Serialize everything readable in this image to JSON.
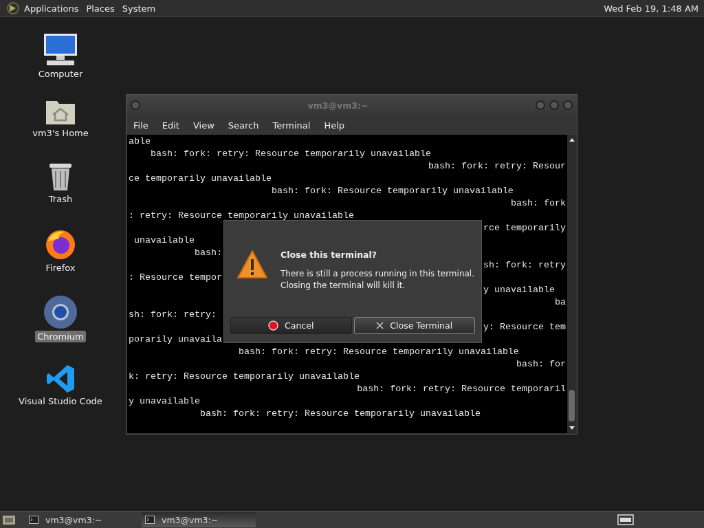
{
  "top_panel": {
    "menus": [
      "Applications",
      "Places",
      "System"
    ],
    "clock": "Wed Feb 19, 1:48 AM"
  },
  "desktop_icons": [
    {
      "kind": "computer",
      "label": "Computer",
      "selected": false
    },
    {
      "kind": "home",
      "label": "vm3's Home",
      "selected": false
    },
    {
      "kind": "trash",
      "label": "Trash",
      "selected": false
    },
    {
      "kind": "firefox",
      "label": "Firefox",
      "selected": false
    },
    {
      "kind": "chromium",
      "label": "Chromium",
      "selected": true
    },
    {
      "kind": "vscode",
      "label": "Visual Studio Code",
      "selected": false
    }
  ],
  "terminal": {
    "title": "vm3@vm3:~",
    "menu": [
      "File",
      "Edit",
      "View",
      "Search",
      "Terminal",
      "Help"
    ],
    "lines": [
      {
        "left": "able"
      },
      {
        "left": "    bash: fork: retry: Resource temporarily unavailable"
      },
      {
        "right": "bash: fork: retry: Resour"
      },
      {
        "left": "ce temporarily unavailable"
      },
      {
        "left": "                          bash: fork: Resource temporarily unavailable"
      },
      {
        "right": "bash: fork"
      },
      {
        "left": ": retry: Resource temporarily unavailable"
      },
      {
        "right": "rce temporarily"
      },
      {
        "left": " unavailable"
      },
      {
        "left": "            bash:"
      },
      {
        "right": "sh: fork: retry"
      },
      {
        "left": ": Resource tempor"
      },
      {
        "right": "y unavailable  "
      },
      {
        "right": "ba"
      },
      {
        "left": "sh: fork: retry:"
      },
      {
        "right": "y: Resource tem"
      },
      {
        "left": "porarily unavaila"
      },
      {
        "left": "                    bash: fork: retry: Resource temporarily unavailable"
      },
      {
        "right": "bash: for"
      },
      {
        "left": "k: retry: Resource temporarily unavailable"
      },
      {
        "right": "bash: fork: retry: Resource temporaril"
      },
      {
        "left": "y unavailable"
      },
      {
        "left": "             bash: fork: retry: Resource temporarily unavailable"
      }
    ]
  },
  "dialog": {
    "title": "Close this terminal?",
    "message": "There is still a process running in this terminal.\nClosing the terminal will kill it.",
    "buttons": [
      {
        "kind": "cancel",
        "label": "Cancel",
        "selected": false
      },
      {
        "kind": "close",
        "label": "Close Terminal",
        "selected": true
      }
    ]
  },
  "taskbar": {
    "tasks": [
      {
        "label": "vm3@vm3:~",
        "selected": false
      },
      {
        "label": "vm3@vm3:~",
        "selected": true
      }
    ]
  }
}
